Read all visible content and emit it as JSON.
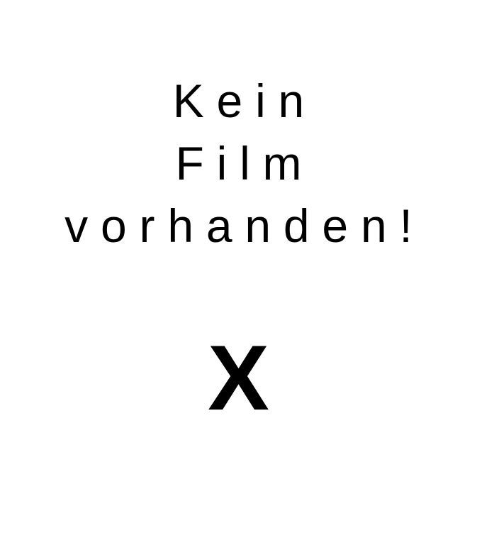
{
  "message": {
    "lines": [
      "Kein",
      "Film",
      "vorhanden!"
    ]
  },
  "close_mark": {
    "symbol": "X"
  }
}
